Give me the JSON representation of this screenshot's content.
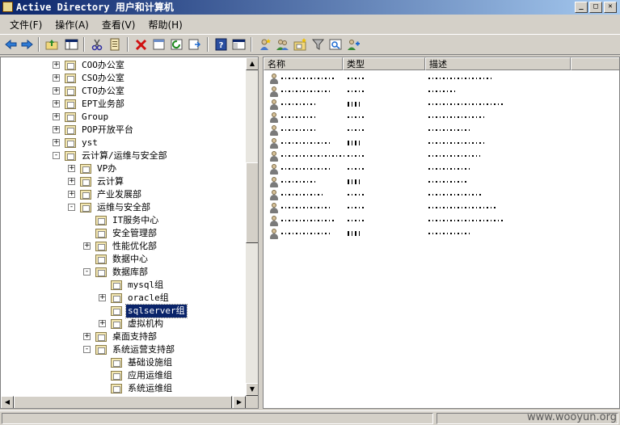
{
  "window": {
    "title": "Active Directory 用户和计算机"
  },
  "menu": [
    "文件(F)",
    "操作(A)",
    "查看(V)",
    "帮助(H)"
  ],
  "toolbar": [
    "back-arrow-icon",
    "forward-arrow-icon",
    "up-folder-icon",
    "show-tree-icon",
    "cut-icon",
    "copy-icon",
    "delete-icon",
    "properties-icon",
    "refresh-icon",
    "export-list-icon",
    "help-icon",
    "console-tree-icon",
    "new-user-icon",
    "new-group-icon",
    "new-ou-icon",
    "filter-icon",
    "find-icon",
    "add-to-group-icon"
  ],
  "tree": [
    {
      "label": "COO办公室",
      "expander": "+",
      "selected": false
    },
    {
      "label": "CSO办公室",
      "expander": "+",
      "selected": false
    },
    {
      "label": "CTO办公室",
      "expander": "+",
      "selected": false
    },
    {
      "label": "EPT业务部",
      "expander": "+",
      "selected": false
    },
    {
      "label": "Group",
      "expander": "+",
      "selected": false
    },
    {
      "label": "POP开放平台",
      "expander": "+",
      "selected": false
    },
    {
      "label": "yst",
      "expander": "+",
      "selected": false
    },
    {
      "label": "云计算/运维与安全部",
      "expander": "-",
      "selected": false
    },
    {
      "label": "VP办",
      "expander": "+",
      "selected": false
    },
    {
      "label": "云计算",
      "expander": "+",
      "selected": false
    },
    {
      "label": "产业发展部",
      "expander": "+",
      "selected": false
    },
    {
      "label": "运维与安全部",
      "expander": "-",
      "selected": false
    },
    {
      "label": "IT服务中心",
      "expander": "",
      "selected": false
    },
    {
      "label": "安全管理部",
      "expander": "",
      "selected": false
    },
    {
      "label": "性能优化部",
      "expander": "+",
      "selected": false
    },
    {
      "label": "数据中心",
      "expander": "",
      "selected": false
    },
    {
      "label": "数据库部",
      "expander": "-",
      "selected": false
    },
    {
      "label": "mysql组",
      "expander": "",
      "selected": false
    },
    {
      "label": "oracle组",
      "expander": "+",
      "selected": false
    },
    {
      "label": "sqlserver组",
      "expander": "",
      "selected": true
    },
    {
      "label": "虚拟机构",
      "expander": "+",
      "selected": false
    },
    {
      "label": "桌面支持部",
      "expander": "+",
      "selected": false
    },
    {
      "label": "系统运营支持部",
      "expander": "-",
      "selected": false
    },
    {
      "label": "基础设施组",
      "expander": "",
      "selected": false
    },
    {
      "label": "应用运维组",
      "expander": "",
      "selected": false
    },
    {
      "label": "系统运维组",
      "expander": "",
      "selected": false
    }
  ],
  "list": {
    "columns": [
      "名称",
      "类型",
      "描述"
    ],
    "row_count": 13
  },
  "watermark": "www.wooyun.org"
}
